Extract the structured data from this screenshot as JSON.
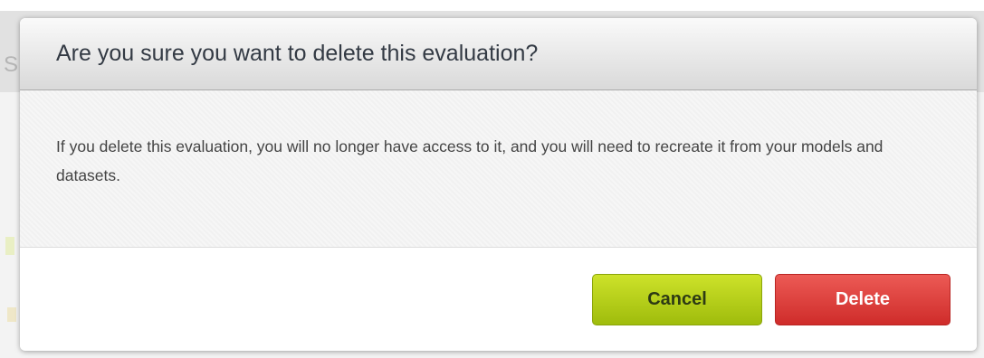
{
  "dialog": {
    "title": "Are you sure you want to delete this evaluation?",
    "message": "If you delete this evaluation, you will no longer have access to it, and you will need to recreate it from your models and datasets.",
    "cancel_label": "Cancel",
    "delete_label": "Delete"
  },
  "colors": {
    "cancel_button": "#b5cf1a",
    "delete_button": "#e04440",
    "header_text": "#333a44"
  }
}
